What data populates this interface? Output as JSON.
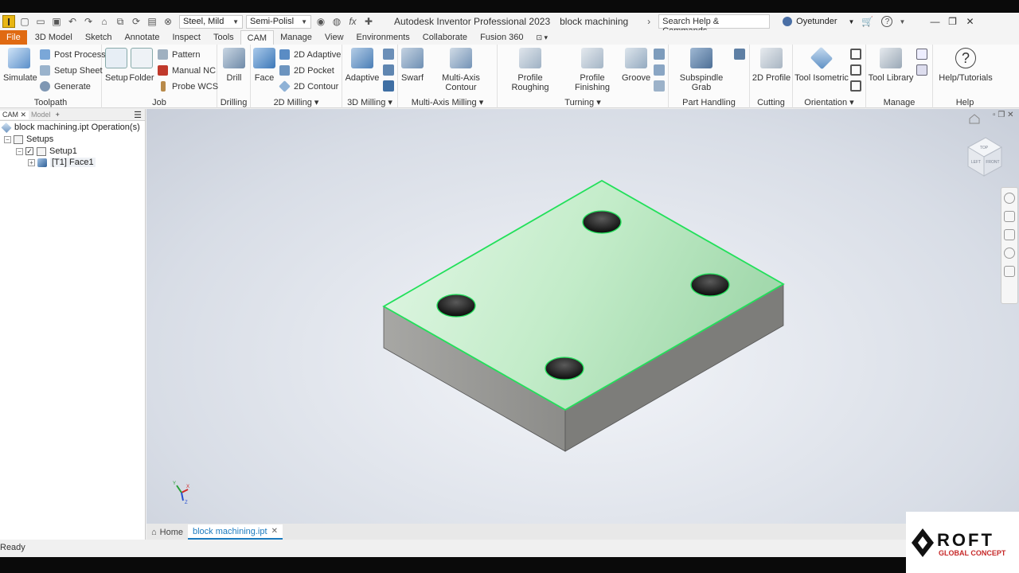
{
  "titlebar": {
    "logo_letter": "I",
    "material": "Steel, Mild",
    "appearance": "Semi-Polisl",
    "app_title": "Autodesk Inventor Professional 2023",
    "doc_title": "block machining",
    "search_placeholder": "Search Help & Commands...",
    "user_name": "Oyetunder",
    "help_glyph": "?"
  },
  "menu": {
    "tabs": [
      "File",
      "3D Model",
      "Sketch",
      "Annotate",
      "Inspect",
      "Tools",
      "CAM",
      "Manage",
      "View",
      "Environments",
      "Collaborate",
      "Fusion 360"
    ],
    "active_tab": "CAM"
  },
  "ribbon": {
    "toolpath": {
      "label": "Toolpath",
      "simulate": "Simulate",
      "post_process": "Post Process",
      "setup_sheet": "Setup Sheet",
      "generate": "Generate"
    },
    "job": {
      "label": "Job",
      "setup": "Setup",
      "folder": "Folder",
      "pattern": "Pattern",
      "manual_nc": "Manual NC",
      "probe_wcs": "Probe WCS"
    },
    "drilling": {
      "label": "Drilling",
      "drill": "Drill"
    },
    "milling2d": {
      "label": "2D Milling",
      "face": "Face",
      "adaptive": "2D Adaptive",
      "pocket": "2D Pocket",
      "contour": "2D Contour"
    },
    "milling3d": {
      "label": "3D Milling",
      "adaptive": "Adaptive"
    },
    "multiaxis": {
      "label": "Multi-Axis Milling",
      "swarf": "Swarf",
      "contour": "Multi-Axis Contour"
    },
    "turning": {
      "label": "Turning",
      "roughing": "Profile Roughing",
      "finishing": "Profile Finishing",
      "groove": "Groove"
    },
    "parthandling": {
      "label": "Part Handling",
      "subspindle": "Subspindle Grab"
    },
    "cutting": {
      "label": "Cutting",
      "profile": "2D Profile"
    },
    "orientation": {
      "label": "Orientation",
      "isometric": "Tool Isometric"
    },
    "manage": {
      "label": "Manage",
      "library": "Tool Library"
    },
    "help": {
      "label": "Help",
      "tutorials": "Help/Tutorials"
    }
  },
  "browser": {
    "tab_cam": "CAM",
    "tab_model": "Model",
    "tab_add": "+",
    "root": "block machining.ipt Operation(s)",
    "setups": "Setups",
    "setup1": "Setup1",
    "face1": "[T1] Face1"
  },
  "viewport": {
    "viewcube_top": "TOP",
    "viewcube_left": "LEFT",
    "viewcube_front": "FRONT",
    "axis_x": "X",
    "axis_y": "Y",
    "axis_z": "Z"
  },
  "doc_tabs": {
    "home": "Home",
    "file": "block machining.ipt",
    "close": "✕"
  },
  "status": {
    "text": "Ready"
  },
  "watermark": {
    "brand": "ROFT",
    "sub": "GLOBAL CONCEPT"
  },
  "colors": {
    "file_tab": "#e06a12",
    "highlight_edge": "#22e05a",
    "face_top": "#bfe9c6",
    "side_face": "#8e8e8e"
  }
}
